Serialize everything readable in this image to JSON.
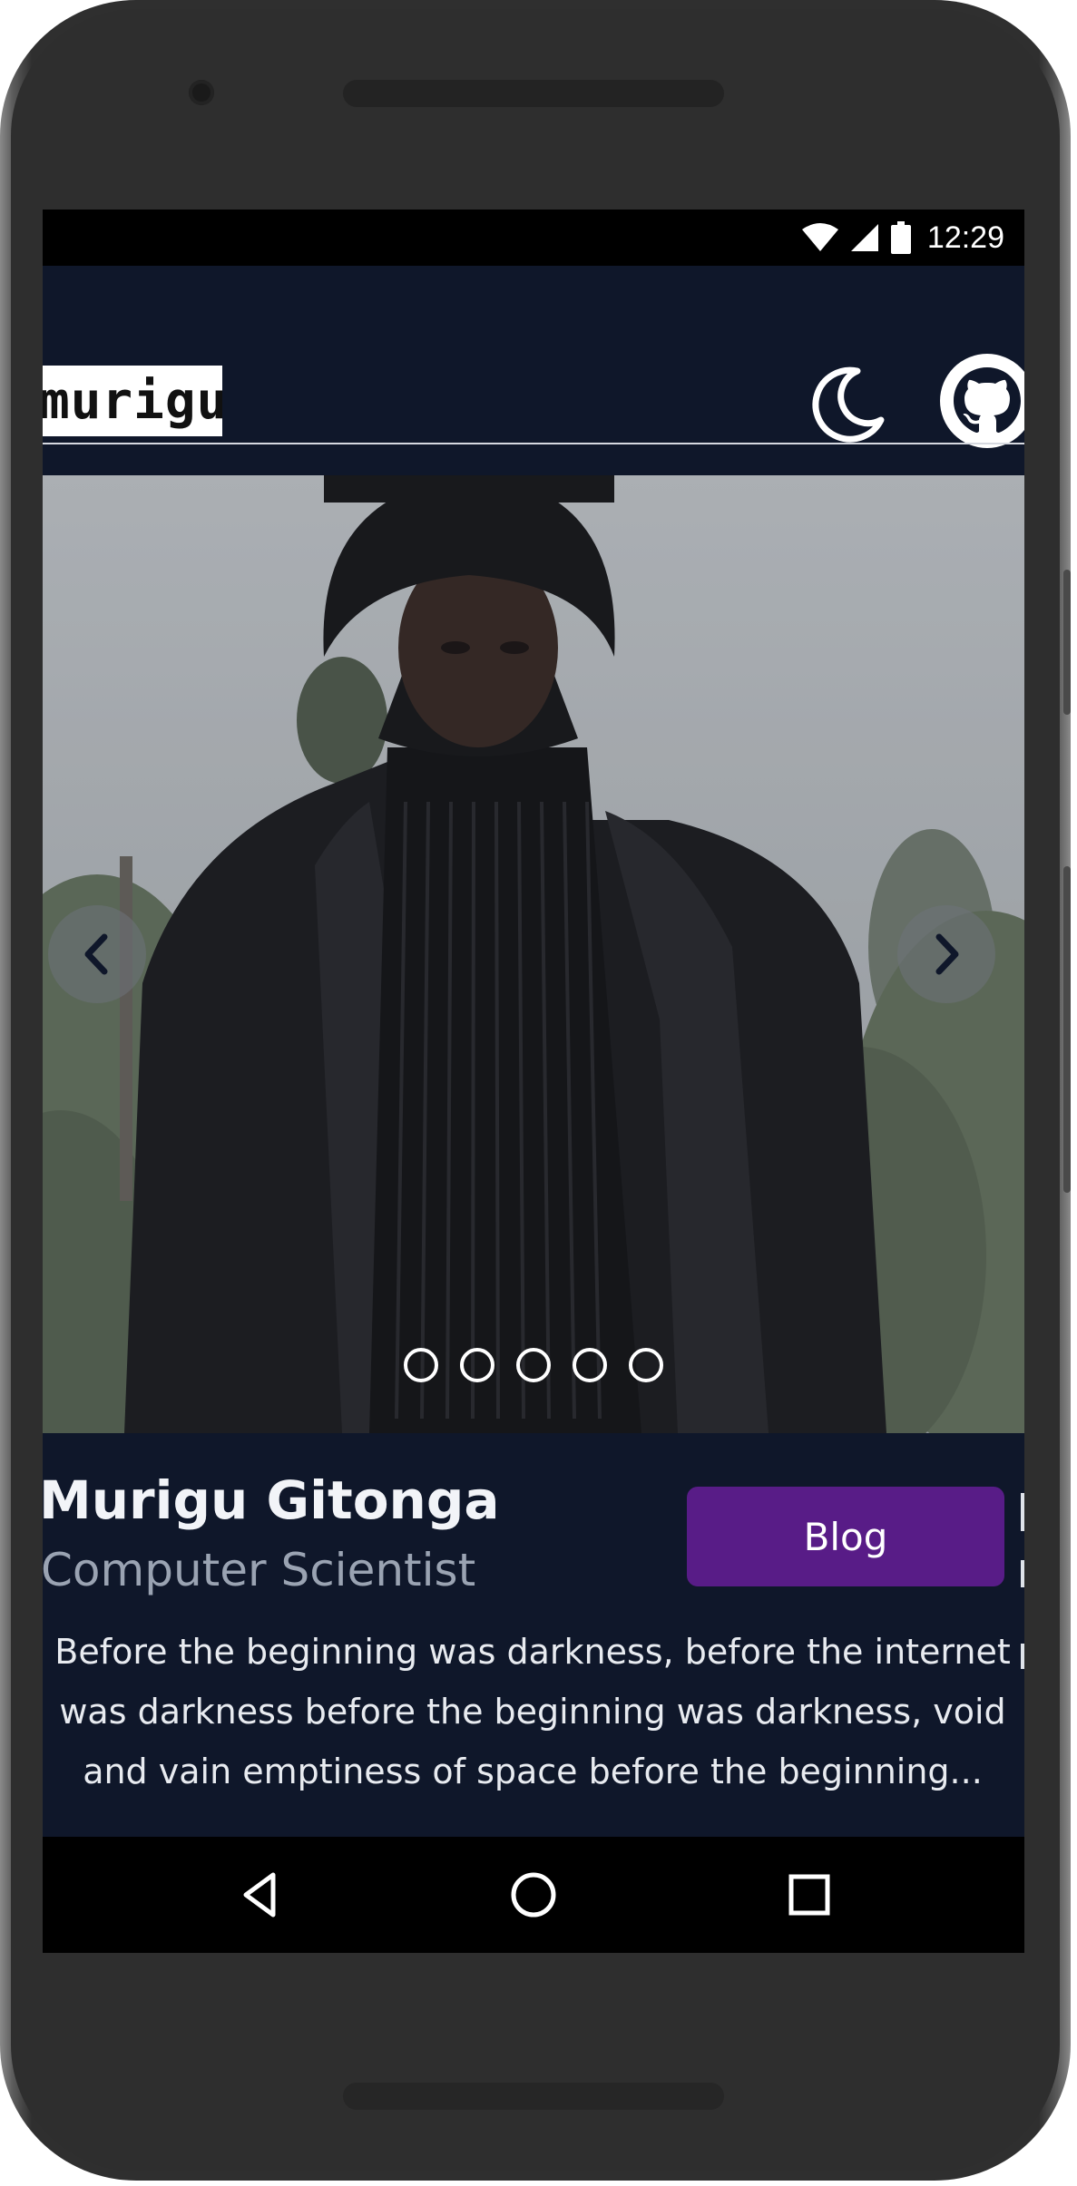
{
  "status_bar": {
    "time": "12:29",
    "icons": [
      "wifi-icon",
      "cell-signal-icon",
      "battery-icon"
    ]
  },
  "navbar": {
    "brand_text": "murigu",
    "theme_toggle_icon": "moon-icon",
    "github_icon": "github-icon"
  },
  "carousel": {
    "prev_icon": "chevron-left-icon",
    "next_icon": "chevron-right-icon",
    "slide_count": 5
  },
  "profile": {
    "name": "Murigu Gitonga",
    "role": "Computer Scientist",
    "blog_button": "Blog",
    "bio_lines": [
      "Before the beginning was darkness, before the internet",
      "was darkness before the beginning was darkness, void",
      "and vain emptiness of space before the beginning..."
    ]
  },
  "system_nav": {
    "back_icon": "back-triangle-icon",
    "home_icon": "home-circle-icon",
    "recents_icon": "recents-square-icon"
  },
  "colors": {
    "page_bg": "#0f172a",
    "accent": "#581c87",
    "text_primary": "#f2f4f8",
    "text_secondary": "#9aa3b2"
  }
}
